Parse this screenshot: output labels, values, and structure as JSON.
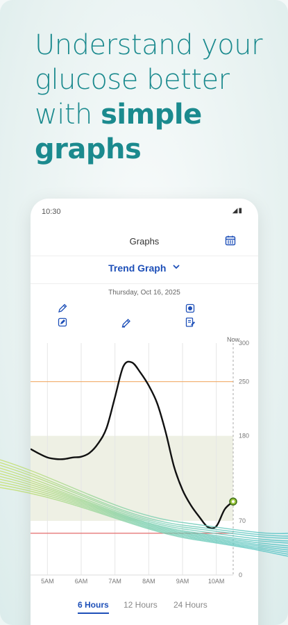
{
  "headline": {
    "line1": "Understand your",
    "line2": "glucose better",
    "line3_plain": "with ",
    "line3_bold": "simple",
    "line4_bold": "graphs"
  },
  "status": {
    "time": "10:30",
    "icons": "◢▮"
  },
  "app": {
    "title": "Graphs",
    "graph_type": "Trend Graph",
    "date": "Thursday, Oct 16, 2025"
  },
  "tabs": [
    "6 Hours",
    "12 Hours",
    "24 Hours"
  ],
  "active_tab": "6 Hours",
  "icons": [
    "calendar-icon",
    "chevron-down-icon",
    "pen-icon",
    "pen-icon",
    "food-icon",
    "note-icon",
    "note-icon"
  ],
  "colors": {
    "accent": "#1d4fb8",
    "headline": "#1b8a8e",
    "high_line": "#f0a35a",
    "low_line": "#e36a6a",
    "target_band": "#eef0e4",
    "current_point": "#9bc53d"
  },
  "chart_data": {
    "type": "line",
    "x_ticks": [
      "5AM",
      "6AM",
      "7AM",
      "8AM",
      "9AM",
      "10AM"
    ],
    "y_ticks": [
      0,
      70,
      180,
      250,
      300
    ],
    "now_label": "Now",
    "ylim": [
      0,
      300
    ],
    "target_range": [
      70,
      180
    ],
    "high_threshold": 250,
    "low_threshold": 54,
    "series": [
      {
        "x": [
          4.5,
          4.75,
          5.0,
          5.25,
          5.5,
          5.75,
          6.0,
          6.25,
          6.5,
          6.75,
          7.0,
          7.25,
          7.5,
          7.75,
          8.0,
          8.25,
          8.5,
          8.75,
          9.0,
          9.25,
          9.5,
          9.75,
          10.0,
          10.25,
          10.5
        ],
        "y": [
          163,
          157,
          152,
          150,
          150,
          152,
          153,
          158,
          170,
          190,
          230,
          270,
          275,
          262,
          245,
          222,
          185,
          140,
          110,
          90,
          75,
          62,
          63,
          85,
          95
        ]
      }
    ]
  }
}
